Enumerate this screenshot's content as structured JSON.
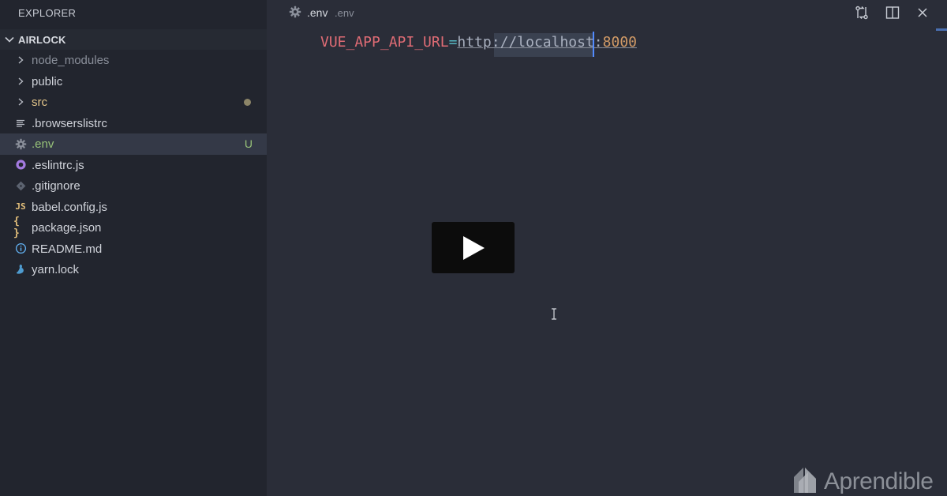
{
  "sidebar": {
    "title": "EXPLORER",
    "project": "AIRLOCK",
    "items": [
      {
        "label": "node_modules",
        "icon": "chevron-right-icon"
      },
      {
        "label": "public",
        "icon": "chevron-right-icon"
      },
      {
        "label": "src",
        "icon": "chevron-right-icon"
      },
      {
        "label": ".browserslistrc",
        "icon": "lines-icon"
      },
      {
        "label": ".env",
        "icon": "gear-icon",
        "badge": "U"
      },
      {
        "label": ".eslintrc.js",
        "icon": "eslint-icon"
      },
      {
        "label": ".gitignore",
        "icon": "git-icon"
      },
      {
        "label": "babel.config.js",
        "icon": "js-icon",
        "icon_text": "JS"
      },
      {
        "label": "package.json",
        "icon": "json-icon",
        "icon_text": "{ }"
      },
      {
        "label": "README.md",
        "icon": "info-icon"
      },
      {
        "label": "yarn.lock",
        "icon": "yarn-icon"
      }
    ]
  },
  "editor": {
    "tab": {
      "title": ".env",
      "description": ".env"
    },
    "code": {
      "key": "VUE_APP_API_URL",
      "operator": "=",
      "url": "http://localhost:",
      "port": "8000"
    }
  },
  "watermark": {
    "text": "Aprendible"
  },
  "colors": {
    "sidebar_bg": "#22252e",
    "editor_bg": "#2a2d38",
    "active_item_bg": "#343947",
    "untracked_green": "#98c379",
    "modified_yellow": "#e3c58a",
    "key_red": "#e06c75",
    "number_orange": "#d19a66",
    "cursor_blue": "#528bff"
  }
}
